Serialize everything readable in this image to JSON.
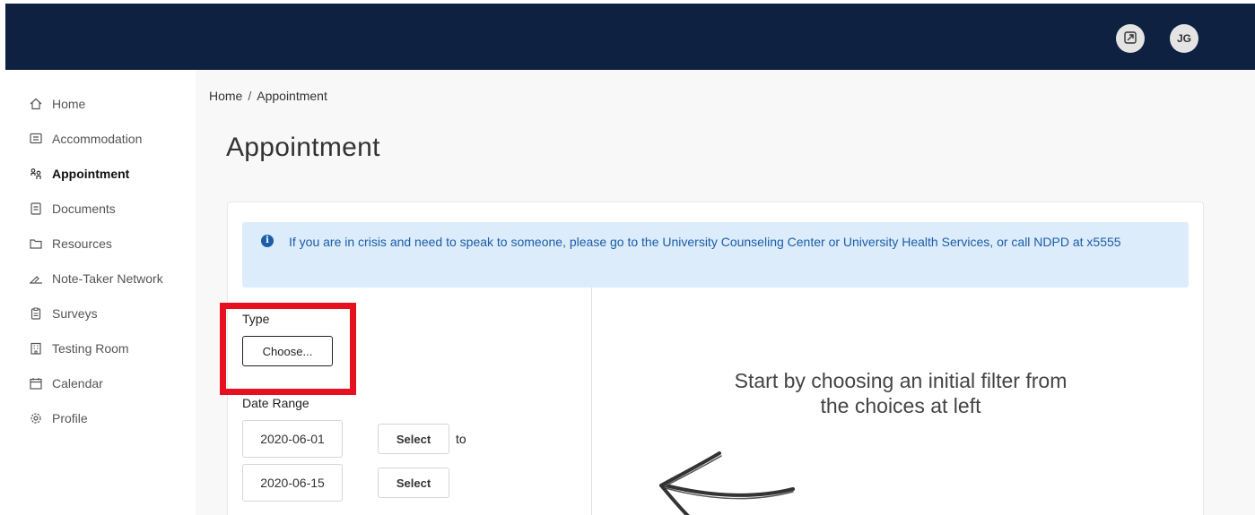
{
  "header": {
    "expand_icon": "expand-icon",
    "avatar_initials": "JG"
  },
  "sidebar": {
    "items": [
      {
        "label": "Home",
        "icon": "home-icon"
      },
      {
        "label": "Accommodation",
        "icon": "list-icon"
      },
      {
        "label": "Appointment",
        "icon": "people-icon",
        "active": true
      },
      {
        "label": "Documents",
        "icon": "document-icon"
      },
      {
        "label": "Resources",
        "icon": "folder-icon"
      },
      {
        "label": "Note-Taker Network",
        "icon": "pencil-icon"
      },
      {
        "label": "Surveys",
        "icon": "clipboard-icon"
      },
      {
        "label": "Testing Room",
        "icon": "building-icon"
      },
      {
        "label": "Calendar",
        "icon": "calendar-icon"
      },
      {
        "label": "Profile",
        "icon": "gear-icon"
      }
    ]
  },
  "breadcrumb": {
    "home": "Home",
    "separator": "/",
    "current": "Appointment"
  },
  "page": {
    "title": "Appointment"
  },
  "alert": {
    "icon": "info-icon",
    "text": "If you are in crisis and need to speak to someone, please go to the University Counseling Center or University Health Services, or call NDPD at x5555"
  },
  "filters": {
    "type_label": "Type",
    "type_button": "Choose...",
    "date_range_label": "Date Range",
    "start_date": "2020-06-01",
    "end_date": "2020-06-15",
    "select_label": "Select",
    "to_label": "to"
  },
  "hint": {
    "text": "Start by choosing an initial filter from the choices at left"
  },
  "colors": {
    "topbar": "#0e2140",
    "alert_bg": "#dcecfb",
    "alert_text": "#1a5da8",
    "highlight": "#e6101f"
  }
}
